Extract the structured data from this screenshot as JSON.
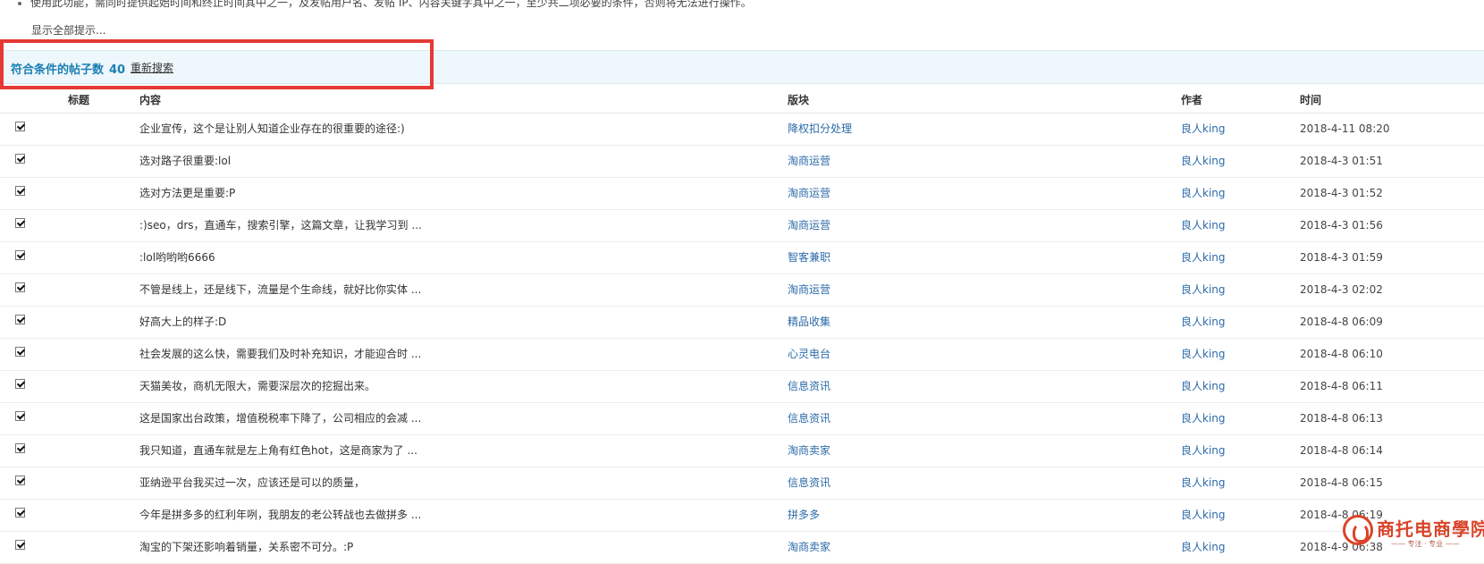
{
  "notice": {
    "tip_text": "使用此功能，需同时提供起始时间和终止时间其中之一，及发帖用户名、发帖 IP、内容关键字其中之一，至少共二项必要的条件，否则将无法进行操作。",
    "show_all_label": "显示全部提示..."
  },
  "result": {
    "label": "符合条件的帖子数",
    "count": "40",
    "research_label": "重新搜索"
  },
  "table": {
    "headers": {
      "title": "标题",
      "content": "内容",
      "forum": "版块",
      "author": "作者",
      "time": "时间"
    },
    "rows": [
      {
        "checked": true,
        "content": "企业宣传，这个是让别人知道企业存在的很重要的途径:)",
        "forum": "降权扣分处理",
        "author": "良人king",
        "time": "2018-4-11 08:20"
      },
      {
        "checked": true,
        "content": "选对路子很重要:lol",
        "forum": "淘商运营",
        "author": "良人king",
        "time": "2018-4-3 01:51"
      },
      {
        "checked": true,
        "content": "选对方法更是重要:P",
        "forum": "淘商运营",
        "author": "良人king",
        "time": "2018-4-3 01:52"
      },
      {
        "checked": true,
        "content": ":)seo，drs，直通车，搜索引擎，这篇文章，让我学习到 ...",
        "forum": "淘商运营",
        "author": "良人king",
        "time": "2018-4-3 01:56"
      },
      {
        "checked": true,
        "content": ":lol哟哟哟6666",
        "forum": "智客兼职",
        "author": "良人king",
        "time": "2018-4-3 01:59"
      },
      {
        "checked": true,
        "content": "不管是线上，还是线下，流量是个生命线，就好比你实体 ...",
        "forum": "淘商运营",
        "author": "良人king",
        "time": "2018-4-3 02:02"
      },
      {
        "checked": true,
        "content": "好高大上的样子:D",
        "forum": "精品收集",
        "author": "良人king",
        "time": "2018-4-8 06:09"
      },
      {
        "checked": true,
        "content": "社会发展的这么快，需要我们及时补充知识，才能迎合时 ...",
        "forum": "心灵电台",
        "author": "良人king",
        "time": "2018-4-8 06:10"
      },
      {
        "checked": true,
        "content": "天猫美妆，商机无限大，需要深层次的挖掘出来。",
        "forum": "信息资讯",
        "author": "良人king",
        "time": "2018-4-8 06:11"
      },
      {
        "checked": true,
        "content": "这是国家出台政策，增值税税率下降了，公司相应的会减 ...",
        "forum": "信息资讯",
        "author": "良人king",
        "time": "2018-4-8 06:13"
      },
      {
        "checked": true,
        "content": "我只知道，直通车就是左上角有红色hot，这是商家为了 ...",
        "forum": "淘商卖家",
        "author": "良人king",
        "time": "2018-4-8 06:14"
      },
      {
        "checked": true,
        "content": "亚纳逊平台我买过一次，应该还是可以的质量，",
        "forum": "信息资讯",
        "author": "良人king",
        "time": "2018-4-8 06:15"
      },
      {
        "checked": true,
        "content": "今年是拼多多的红利年咧，我朋友的老公转战也去做拼多 ...",
        "forum": "拼多多",
        "author": "良人king",
        "time": "2018-4-8 06:19"
      },
      {
        "checked": true,
        "content": "淘宝的下架还影响着销量，关系密不可分。:P",
        "forum": "淘商卖家",
        "author": "良人king",
        "time": "2018-4-9 06:38"
      }
    ]
  },
  "watermark": {
    "logo_text": "商托电商學院",
    "logo_sub": "—— 专注 · 专业 ——",
    "brand_color": "#d9452a"
  },
  "colors": {
    "link": "#2c6aa8",
    "result_title": "#1b7fb5",
    "highlight_box": "#e53935",
    "result_bar_bg": "#eef7fb"
  }
}
